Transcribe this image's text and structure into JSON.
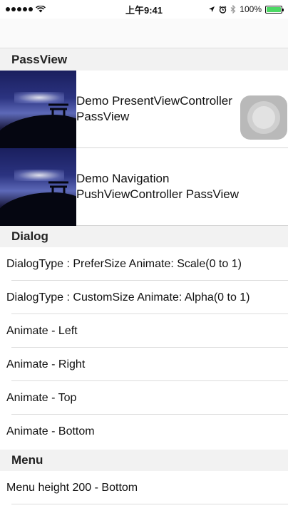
{
  "status_bar": {
    "time": "上午9:41",
    "battery_percent": "100%",
    "battery_level": 1.0,
    "icons": [
      "signal-dots-icon",
      "wifi-icon",
      "location-arrow-icon",
      "alarm-icon",
      "bluetooth-icon",
      "battery-icon"
    ]
  },
  "sections": {
    "passview": {
      "title": "PassView"
    },
    "dialog": {
      "title": "Dialog"
    },
    "menu": {
      "title": "Menu"
    }
  },
  "passview_rows": [
    {
      "label": "Demo PresentViewController PassView"
    },
    {
      "label": "Demo Navigation PushViewController PassView"
    }
  ],
  "dialog_rows": [
    {
      "label": "DialogType : PreferSize Animate: Scale(0 to 1)"
    },
    {
      "label": "DialogType : CustomSize Animate: Alpha(0 to 1)"
    },
    {
      "label": "Animate - Left"
    },
    {
      "label": "Animate - Right"
    },
    {
      "label": "Animate - Top"
    },
    {
      "label": "Animate - Bottom"
    }
  ],
  "menu_rows": [
    {
      "label": "Menu height 200 - Bottom"
    }
  ],
  "colors": {
    "section_bg": "#f2f2f2",
    "battery": "#4cd964",
    "float_button": "#b9b9b9"
  }
}
